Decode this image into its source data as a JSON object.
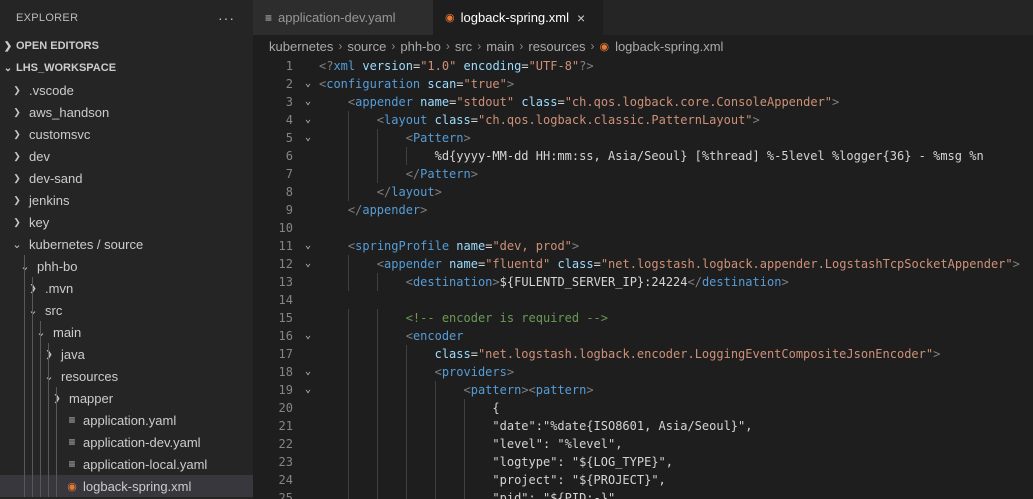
{
  "explorer": {
    "title": "EXPLORER",
    "more": "···"
  },
  "sections": {
    "open_editors": "OPEN EDITORS",
    "workspace": "LHS_WORKSPACE"
  },
  "tree": [
    {
      "label": ".vscode",
      "type": "folder"
    },
    {
      "label": "aws_handson",
      "type": "folder"
    },
    {
      "label": "customsvc",
      "type": "folder"
    },
    {
      "label": "dev",
      "type": "folder"
    },
    {
      "label": "dev-sand",
      "type": "folder"
    },
    {
      "label": "jenkins",
      "type": "folder"
    },
    {
      "label": "key",
      "type": "folder"
    },
    {
      "label": "kubernetes / source",
      "type": "folder-open"
    },
    {
      "label": "phh-bo",
      "type": "folder-open"
    },
    {
      "label": ".mvn",
      "type": "folder"
    },
    {
      "label": "src",
      "type": "folder-open"
    },
    {
      "label": "main",
      "type": "folder-open"
    },
    {
      "label": "java",
      "type": "folder"
    },
    {
      "label": "resources",
      "type": "folder-open"
    },
    {
      "label": "mapper",
      "type": "folder"
    },
    {
      "label": "application.yaml",
      "type": "file-yaml"
    },
    {
      "label": "application-dev.yaml",
      "type": "file-yaml"
    },
    {
      "label": "application-local.yaml",
      "type": "file-yaml"
    },
    {
      "label": "logback-spring.xml",
      "type": "file-xml",
      "selected": true
    }
  ],
  "tabs": [
    {
      "label": "application-dev.yaml",
      "icon": "lines-icon"
    },
    {
      "label": "logback-spring.xml",
      "icon": "rss-icon",
      "close": "×"
    }
  ],
  "breadcrumb": [
    "kubernetes",
    "source",
    "phh-bo",
    "src",
    "main",
    "resources",
    "logback-spring.xml"
  ],
  "code_lines": [
    {
      "n": "1",
      "fold": "",
      "t": [
        [
          "b",
          "<?"
        ],
        [
          "t",
          "xml"
        ],
        [
          "x",
          " "
        ],
        [
          "a",
          "version"
        ],
        [
          "x",
          "="
        ],
        [
          "s",
          "\"1.0\""
        ],
        [
          "x",
          " "
        ],
        [
          "a",
          "encoding"
        ],
        [
          "x",
          "="
        ],
        [
          "s",
          "\"UTF-8\""
        ],
        [
          "b",
          "?>"
        ]
      ]
    },
    {
      "n": "2",
      "fold": "v",
      "t": [
        [
          "b",
          "<"
        ],
        [
          "t",
          "configuration"
        ],
        [
          "x",
          " "
        ],
        [
          "a",
          "scan"
        ],
        [
          "x",
          "="
        ],
        [
          "s",
          "\"true\""
        ],
        [
          "b",
          ">"
        ]
      ]
    },
    {
      "n": "3",
      "fold": "v",
      "t": [
        [
          "x",
          "    "
        ],
        [
          "b",
          "<"
        ],
        [
          "t",
          "appender"
        ],
        [
          "x",
          " "
        ],
        [
          "a",
          "name"
        ],
        [
          "x",
          "="
        ],
        [
          "s",
          "\"stdout\""
        ],
        [
          "x",
          " "
        ],
        [
          "a",
          "class"
        ],
        [
          "x",
          "="
        ],
        [
          "s",
          "\"ch.qos.logback.core.ConsoleAppender\""
        ],
        [
          "b",
          ">"
        ]
      ]
    },
    {
      "n": "4",
      "fold": "v",
      "t": [
        [
          "x",
          "        "
        ],
        [
          "b",
          "<"
        ],
        [
          "t",
          "layout"
        ],
        [
          "x",
          " "
        ],
        [
          "a",
          "class"
        ],
        [
          "x",
          "="
        ],
        [
          "s",
          "\"ch.qos.logback.classic.PatternLayout\""
        ],
        [
          "b",
          ">"
        ]
      ]
    },
    {
      "n": "5",
      "fold": "v",
      "t": [
        [
          "x",
          "            "
        ],
        [
          "b",
          "<"
        ],
        [
          "t",
          "Pattern"
        ],
        [
          "b",
          ">"
        ]
      ]
    },
    {
      "n": "6",
      "fold": "",
      "t": [
        [
          "x",
          "                %d{yyyy-MM-dd HH:mm:ss, Asia/Seoul} [%thread] %-5level %logger{36} - %msg %n"
        ]
      ]
    },
    {
      "n": "7",
      "fold": "",
      "t": [
        [
          "x",
          "            "
        ],
        [
          "b",
          "</"
        ],
        [
          "t",
          "Pattern"
        ],
        [
          "b",
          ">"
        ]
      ]
    },
    {
      "n": "8",
      "fold": "",
      "t": [
        [
          "x",
          "        "
        ],
        [
          "b",
          "</"
        ],
        [
          "t",
          "layout"
        ],
        [
          "b",
          ">"
        ]
      ]
    },
    {
      "n": "9",
      "fold": "",
      "t": [
        [
          "x",
          "    "
        ],
        [
          "b",
          "</"
        ],
        [
          "t",
          "appender"
        ],
        [
          "b",
          ">"
        ]
      ]
    },
    {
      "n": "10",
      "fold": "",
      "t": []
    },
    {
      "n": "11",
      "fold": "v",
      "t": [
        [
          "x",
          "    "
        ],
        [
          "b",
          "<"
        ],
        [
          "t",
          "springProfile"
        ],
        [
          "x",
          " "
        ],
        [
          "a",
          "name"
        ],
        [
          "x",
          "="
        ],
        [
          "s",
          "\"dev, prod\""
        ],
        [
          "b",
          ">"
        ]
      ]
    },
    {
      "n": "12",
      "fold": "v",
      "t": [
        [
          "x",
          "        "
        ],
        [
          "b",
          "<"
        ],
        [
          "t",
          "appender"
        ],
        [
          "x",
          " "
        ],
        [
          "a",
          "name"
        ],
        [
          "x",
          "="
        ],
        [
          "s",
          "\"fluentd\""
        ],
        [
          "x",
          " "
        ],
        [
          "a",
          "class"
        ],
        [
          "x",
          "="
        ],
        [
          "s",
          "\"net.logstash.logback.appender.LogstashTcpSocketAppender\""
        ],
        [
          "b",
          ">"
        ]
      ]
    },
    {
      "n": "13",
      "fold": "",
      "t": [
        [
          "x",
          "            "
        ],
        [
          "b",
          "<"
        ],
        [
          "t",
          "destination"
        ],
        [
          "b",
          ">"
        ],
        [
          "x",
          "${FULENTD_SERVER_IP}:24224"
        ],
        [
          "b",
          "</"
        ],
        [
          "t",
          "destination"
        ],
        [
          "b",
          ">"
        ]
      ]
    },
    {
      "n": "14",
      "fold": "",
      "t": []
    },
    {
      "n": "15",
      "fold": "",
      "t": [
        [
          "x",
          "            "
        ],
        [
          "c",
          "<!-- encoder is required -->"
        ]
      ]
    },
    {
      "n": "16",
      "fold": "v",
      "t": [
        [
          "x",
          "            "
        ],
        [
          "b",
          "<"
        ],
        [
          "t",
          "encoder"
        ]
      ]
    },
    {
      "n": "17",
      "fold": "",
      "t": [
        [
          "x",
          "                "
        ],
        [
          "a",
          "class"
        ],
        [
          "x",
          "="
        ],
        [
          "s",
          "\"net.logstash.logback.encoder.LoggingEventCompositeJsonEncoder\""
        ],
        [
          "b",
          ">"
        ]
      ]
    },
    {
      "n": "18",
      "fold": "v",
      "t": [
        [
          "x",
          "                "
        ],
        [
          "b",
          "<"
        ],
        [
          "t",
          "providers"
        ],
        [
          "b",
          ">"
        ]
      ]
    },
    {
      "n": "19",
      "fold": "v",
      "t": [
        [
          "x",
          "                    "
        ],
        [
          "b",
          "<"
        ],
        [
          "t",
          "pattern"
        ],
        [
          "b",
          "><"
        ],
        [
          "t",
          "pattern"
        ],
        [
          "b",
          ">"
        ]
      ]
    },
    {
      "n": "20",
      "fold": "",
      "t": [
        [
          "x",
          "                        {"
        ]
      ]
    },
    {
      "n": "21",
      "fold": "",
      "t": [
        [
          "x",
          "                        \"date\":\"%date{ISO8601, Asia/Seoul}\","
        ]
      ]
    },
    {
      "n": "22",
      "fold": "",
      "t": [
        [
          "x",
          "                        \"level\": \"%level\","
        ]
      ]
    },
    {
      "n": "23",
      "fold": "",
      "t": [
        [
          "x",
          "                        \"logtype\": \"${LOG_TYPE}\","
        ]
      ]
    },
    {
      "n": "24",
      "fold": "",
      "t": [
        [
          "x",
          "                        \"project\": \"${PROJECT}\","
        ]
      ]
    },
    {
      "n": "25",
      "fold": "",
      "t": [
        [
          "x",
          "                        \"pid\": \"${PID:-}\""
        ]
      ]
    }
  ]
}
